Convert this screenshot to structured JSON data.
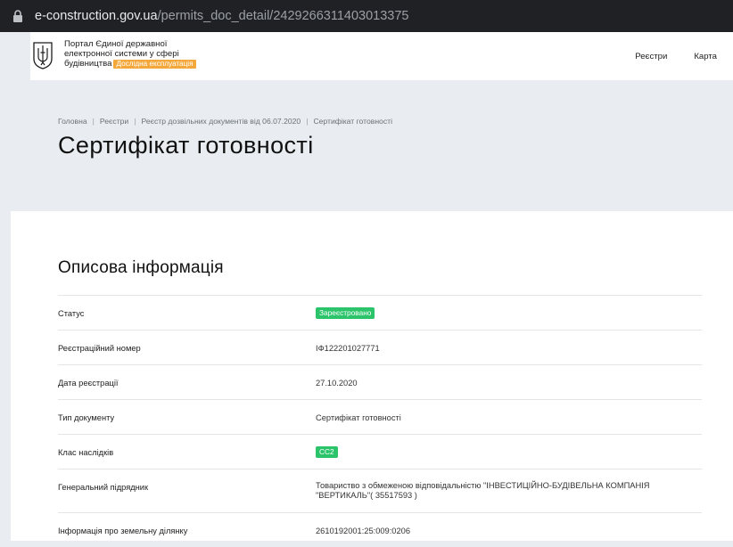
{
  "browser": {
    "url_host": "e-construction.gov.ua",
    "url_path": "/permits_doc_detail/2429266311403013375"
  },
  "header": {
    "portal_line1": "Портал Єдиної державної",
    "portal_line2": "електронної системи у сфері",
    "portal_line3": "будівництва",
    "trial_badge": "Дослідна експлуатація",
    "nav": [
      "Реєстри",
      "Карта"
    ]
  },
  "breadcrumb": [
    "Головна",
    "Реєстри",
    "Реєстр дозвільних документів від 06.07.2020",
    "Сертифікат готовності"
  ],
  "page_title": "Сертифікат готовності",
  "section_title": "Описова інформація",
  "rows": [
    {
      "label": "Статус",
      "value": "Зареєстровано",
      "pill": true
    },
    {
      "label": "Реєстраційний номер",
      "value": "ІФ122201027771"
    },
    {
      "label": "Дата реєстрації",
      "value": "27.10.2020"
    },
    {
      "label": "Тип документу",
      "value": "Сертифікат готовності"
    },
    {
      "label": "Клас наслідків",
      "value": "СС2",
      "pill": true
    },
    {
      "label": "Генеральний підрядник",
      "value_line1": "Товариство з обмеженою відповідальністю \"ІНВЕСТИЦІЙНО-БУДІВЕЛЬНА КОМПАНІЯ",
      "value_line2": "\"ВЕРТИКАЛЬ\"( 35517593 )"
    },
    {
      "label": "Інформація про земельну ділянку",
      "value": "2610192001:25:009:0206"
    }
  ],
  "colors": {
    "status_pill": "#2cc46b",
    "trial_badge": "#f4a83c",
    "hero_bg": "#e9edf1"
  },
  "icons": [
    "lock-icon",
    "trident-emblem-icon"
  ]
}
